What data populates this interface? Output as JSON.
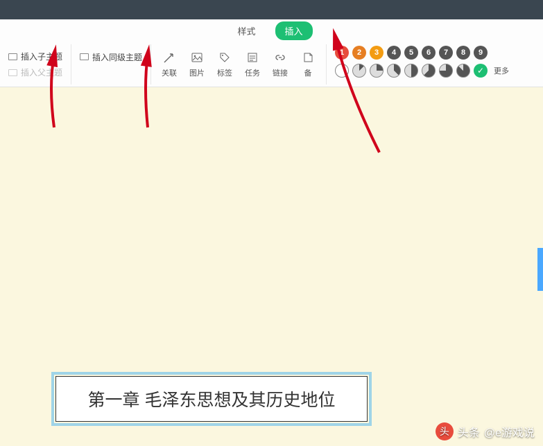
{
  "tabs": {
    "style": "样式",
    "insert": "插入"
  },
  "insert": {
    "child": "插入子主题",
    "sibling": "插入同级主题",
    "parent": "插入父主题"
  },
  "tools": {
    "relation": "关联",
    "image": "图片",
    "label": "标签",
    "task": "任务",
    "link": "链接",
    "note": "备"
  },
  "markers": {
    "numbers": [
      "1",
      "2",
      "3",
      "4",
      "5",
      "6",
      "7",
      "8",
      "9"
    ],
    "colors": [
      "#e74c3c",
      "#e67e22",
      "#f39c12",
      "#555555",
      "#555555",
      "#555555",
      "#555555",
      "#555555",
      "#555555"
    ],
    "more": "更多"
  },
  "node_text": "第一章 毛泽东思想及其历史地位",
  "watermark": {
    "prefix": "头条",
    "handle": "@e游戏说"
  }
}
